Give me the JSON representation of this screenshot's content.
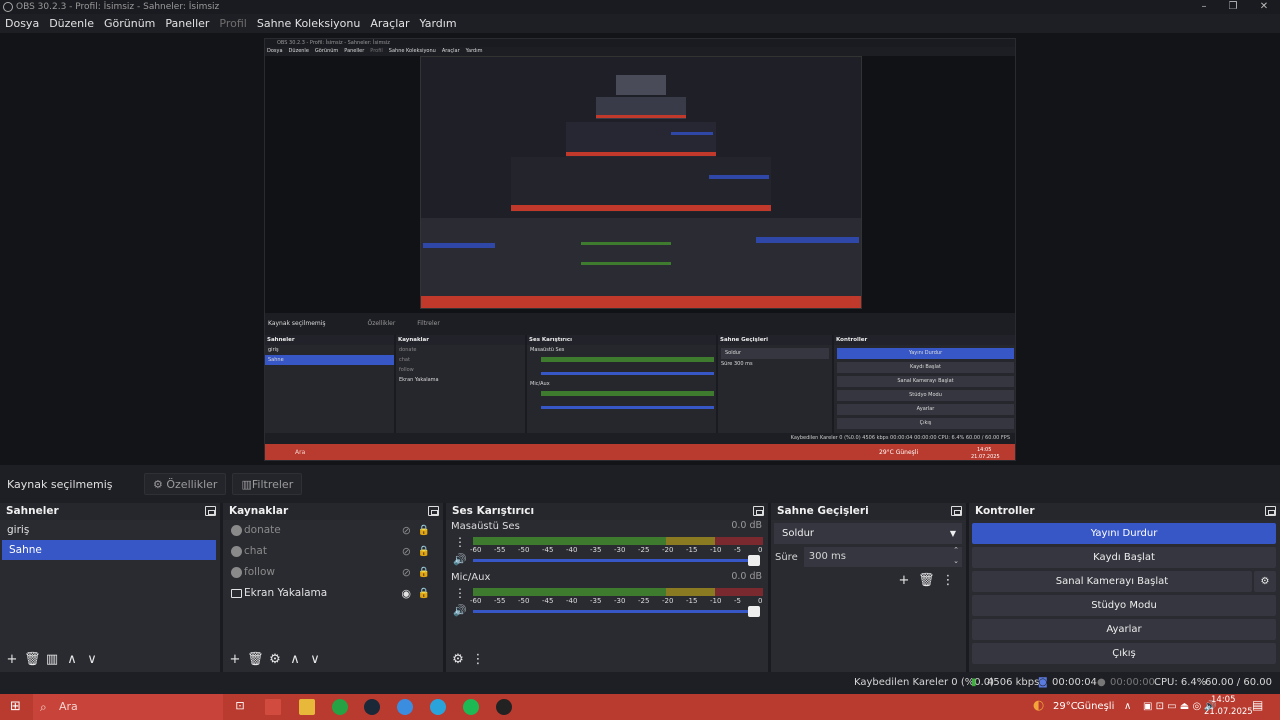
{
  "window": {
    "title": "OBS 30.2.3 - Profil: İsimsiz - Sahneler: İsimsiz"
  },
  "menu": {
    "items": [
      "Dosya",
      "Düzenle",
      "Görünüm",
      "Paneller",
      "Profil",
      "Sahne Koleksiyonu",
      "Araçlar",
      "Yardım"
    ],
    "disabled": "Profil"
  },
  "nested": {
    "title": "OBS 30.2.3 - Profil: İsimsiz - Sahneler: İsimsiz",
    "source_status": "Kaynak seçilmemiş",
    "props": "Özellikler",
    "filters": "Filtreler",
    "docks": {
      "scenes": "Sahneler",
      "sources": "Kaynaklar",
      "mixer": "Ses Karıştırıcı",
      "transitions": "Sahne Geçişleri",
      "controls": "Kontroller"
    },
    "scenes": [
      "giriş",
      "Sahne"
    ],
    "sources": [
      "donate",
      "chat",
      "follow",
      "Ekran Yakalama"
    ],
    "mixer": [
      "Masaüstü Ses",
      "Mic/Aux"
    ],
    "transition": "Soldur",
    "duration_label": "Süre",
    "duration": "300 ms",
    "controls": [
      "Yayını Durdur",
      "Kaydı Başlat",
      "Sanal Kamerayı Başlat",
      "Stüdyo Modu",
      "Ayarlar",
      "Çıkış"
    ],
    "status": "Kaybedilen Kareler 0 (%0.0)   4506 kbps   00:00:04   00:00:00   CPU: 6.4%   60.00 / 60.00 FPS",
    "search": "Ara",
    "weather": "29°C Güneşli",
    "clock": "14:05",
    "date": "21.07.2025"
  },
  "source_bar": {
    "status": "Kaynak seçilmemiş",
    "properties": "Özellikler",
    "filters": "Filtreler"
  },
  "scenes": {
    "title": "Sahneler",
    "items": [
      "giriş",
      "Sahne"
    ],
    "selected": 1
  },
  "sources": {
    "title": "Kaynaklar",
    "items": [
      {
        "name": "donate",
        "visible": false
      },
      {
        "name": "chat",
        "visible": false
      },
      {
        "name": "follow",
        "visible": false
      },
      {
        "name": "Ekran Yakalama",
        "visible": true
      }
    ]
  },
  "mixer": {
    "title": "Ses Karıştırıcı",
    "channels": [
      {
        "name": "Masaüstü Ses",
        "db": "0.0 dB",
        "level": 1.0
      },
      {
        "name": "Mic/Aux",
        "db": "0.0 dB",
        "level": 1.0
      }
    ],
    "ticks": [
      "-60",
      "-55",
      "-50",
      "-45",
      "-40",
      "-35",
      "-30",
      "-25",
      "-20",
      "-15",
      "-10",
      "-5",
      "0"
    ]
  },
  "transitions": {
    "title": "Sahne Geçişleri",
    "selected": "Soldur",
    "duration_label": "Süre",
    "duration": "300 ms"
  },
  "controls": {
    "title": "Kontroller",
    "buttons": [
      "Yayını Durdur",
      "Kaydı Başlat",
      "Sanal Kamerayı Başlat",
      "Stüdyo Modu",
      "Ayarlar",
      "Çıkış"
    ]
  },
  "status": {
    "dropped": "Kaybedilen Kareler 0 (%0.0)",
    "bitrate": "4506 kbps",
    "stream_time": "00:00:04",
    "rec_time": "00:00:00",
    "cpu": "CPU: 6.4%",
    "fps": "60.00 / 60.00 FPS"
  },
  "taskbar": {
    "search": "Ara",
    "weather": "29°C",
    "weather_desc": "Güneşli",
    "time": "14:05",
    "date": "21.07.2025"
  },
  "colors": {
    "accent": "#3757c6",
    "taskbar": "#b93a2e",
    "meter_green": "#3e7b2e",
    "meter_yellow": "#8a7a22",
    "meter_red": "#7a2a2e"
  }
}
